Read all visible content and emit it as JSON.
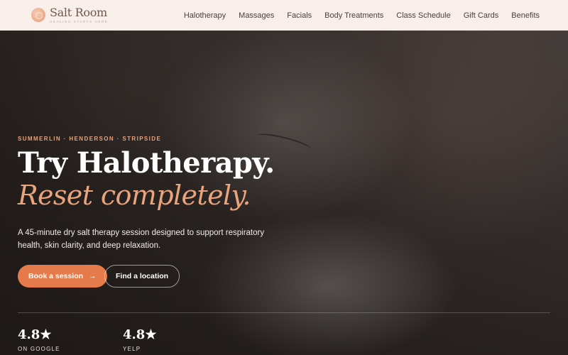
{
  "header": {
    "logo": {
      "name": "Salt Room",
      "tagline": "Healing Starts Here"
    },
    "nav": [
      {
        "label": "Halotherapy"
      },
      {
        "label": "Massages"
      },
      {
        "label": "Facials"
      },
      {
        "label": "Body Treatments"
      },
      {
        "label": "Class Schedule"
      },
      {
        "label": "Gift Cards"
      },
      {
        "label": "Benefits"
      }
    ]
  },
  "hero": {
    "eyebrow": "SUMMERLIN · HENDERSON · STRIPSIDE",
    "title_line1": "Try Halotherapy.",
    "title_line2": "Reset completely.",
    "description": "A 45-minute dry salt therapy session designed to support respiratory health, skin clarity, and deep relaxation.",
    "primary_button": {
      "label": "Book a session",
      "icon": "arrow-right-icon",
      "arrow": "→"
    },
    "secondary_button": {
      "label": "Find a location"
    },
    "ratings": [
      {
        "value": "4.8★",
        "label": "ON GOOGLE"
      },
      {
        "value": "4.8★",
        "label": "YELP"
      }
    ]
  },
  "colors": {
    "accent": "#e57a4a",
    "accent_text": "#e9a47d",
    "header_bg": "#f8efea"
  }
}
